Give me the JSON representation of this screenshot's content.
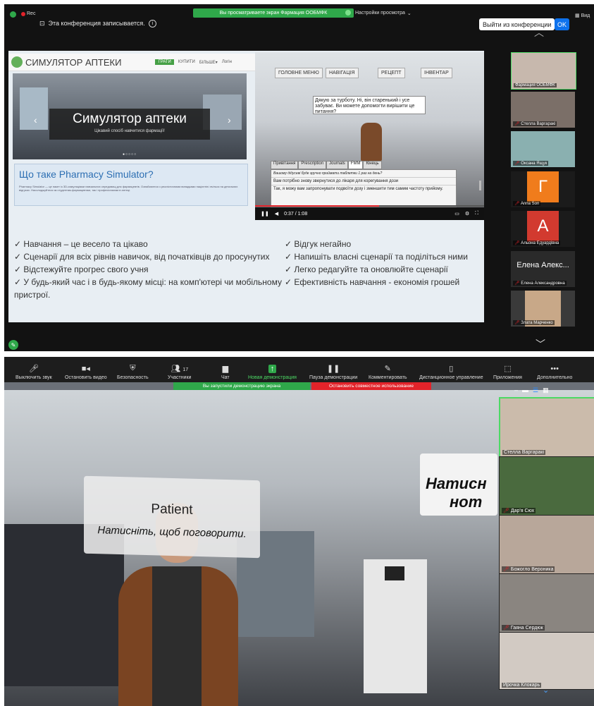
{
  "top_window": {
    "rec_label": "Rec",
    "recording_notice": "Эта конференция записывается.",
    "green_banner": "Вы просматриваете экран Фармация ООБМФК",
    "view_options": "Настройки просмотра",
    "exit_button": "Выйти из конференции",
    "ok_button": "OK",
    "right_cut": "Вид"
  },
  "slide": {
    "site_title": "СИМУЛЯТОР АПТЕКИ",
    "nav": [
      "ГРАТИ",
      "КУПИТИ",
      "БІЛЬШЕ▾",
      "Логін"
    ],
    "hero_title": "Симулятор аптеки",
    "hero_subtitle": "Цікавий спосіб навчитися фармації!",
    "what_title": "Що таке Pharmacy Simulator?",
    "what_desc": "Pharmacy Simulator — це пакет із 3D-симуляціями навчальних середовищ для фармацевтів. Ознайомтеся з реалістичними випадками пацієнтів і вчіться на детальних відгуках. Насолоджуйтеся як студентам-фармацевтам, так і професіоналам в аптеці.",
    "game_tabs": [
      "ГОЛОВНЕ МЕНЮ",
      "НАВІГАЦІЯ",
      "РЕЦЕПТ",
      "ІНВЕНТАР"
    ],
    "dialog": "Дякую за турботу. Ні, він старенький і усе забуває. Ви можете допомогти вирішити це питання?",
    "choice_tabs": [
      "Привітання",
      "Prescription",
      "Journals",
      "FMM",
      "Кінець"
    ],
    "choice_header": "Вашому дідусеві буде зручно приймати таблетки 1 раз на день?",
    "choices": [
      "Вам потрібно знову звернутися до лікаря для корегування дози",
      "Так, я можу вам запропонувати подвоїти дозу і зменшити тим самим частоту прийому."
    ],
    "video_time": "0:37 / 1:08",
    "bullets_left": [
      "✓ Навчання – це весело та цікаво",
      "✓ Сценарії для всіх рівнів навичок, від початківців до просунутих",
      "✓ Відстежуйте прогрес свого учня",
      "✓ У будь-який час і в будь-якому місці: на комп'ютері чи мобільному пристрої."
    ],
    "bullets_right": [
      "✓ Відгук негайно",
      "✓ Напишіть власні сценарії та поділіться ними",
      "✓ Легко редагуйте та оновлюйте сценарії",
      "✓ Ефективність навчання - економія грошей"
    ]
  },
  "top_participants": [
    {
      "name": "Фармация ООБМФК",
      "color": "#9a8a7e"
    },
    {
      "name": "Стелла Варгаракі",
      "color": "#7b6f68"
    },
    {
      "name": "Оксана Ящук",
      "color": "#8ab0b0"
    },
    {
      "name": "Anna Son",
      "letter": "Г",
      "color": "#f07c1c"
    },
    {
      "name": "Альона Едуардівна",
      "letter": "A",
      "color": "#d23a2f"
    },
    {
      "name": "Елена Александровна",
      "display": "Елена Алекс...",
      "color": "#2a2a2a"
    },
    {
      "name": "Злата Марченко",
      "color": "#9c8064"
    }
  ],
  "toolbar": {
    "items": [
      {
        "icon": "🎤",
        "label": "Выключить звук"
      },
      {
        "icon": "▶",
        "label": "Остановить видео"
      },
      {
        "icon": "🛡",
        "label": "Безопасность"
      },
      {
        "icon": "👥",
        "label": "Участники",
        "count": "17"
      },
      {
        "icon": "💬",
        "label": "Чат"
      },
      {
        "icon": "↑",
        "label": "Новая демонстрация"
      },
      {
        "icon": "II",
        "label": "Пауза демонстрации"
      },
      {
        "icon": "✎",
        "label": "Комментировать"
      },
      {
        "icon": "🖱",
        "label": "Дистанционное управление"
      },
      {
        "icon": "⬚",
        "label": "Приложения"
      },
      {
        "icon": "•••",
        "label": "Дополнительно"
      }
    ]
  },
  "share_banner": "Вы запустили демонстрацию экрана",
  "stop_banner": "Остановить совместное использование",
  "game_scene": {
    "patient_title": "Patient",
    "patient_prompt": "Натисніть, щоб поговорити.",
    "sign_text_1": "Натисн",
    "sign_text_2": "нот"
  },
  "bottom_participants": [
    {
      "name": "Стелла Варгаракі",
      "color": "#c9b8a8"
    },
    {
      "name": "Дар'я Сюх",
      "color": "#4a6a3e"
    },
    {
      "name": "Божогло Вероника",
      "color": "#b8a79a"
    },
    {
      "name": "Гаяна Сердюк",
      "color": "#8a8580"
    },
    {
      "name": "Ирочка Клокарь",
      "color": "#d2cac3"
    }
  ]
}
